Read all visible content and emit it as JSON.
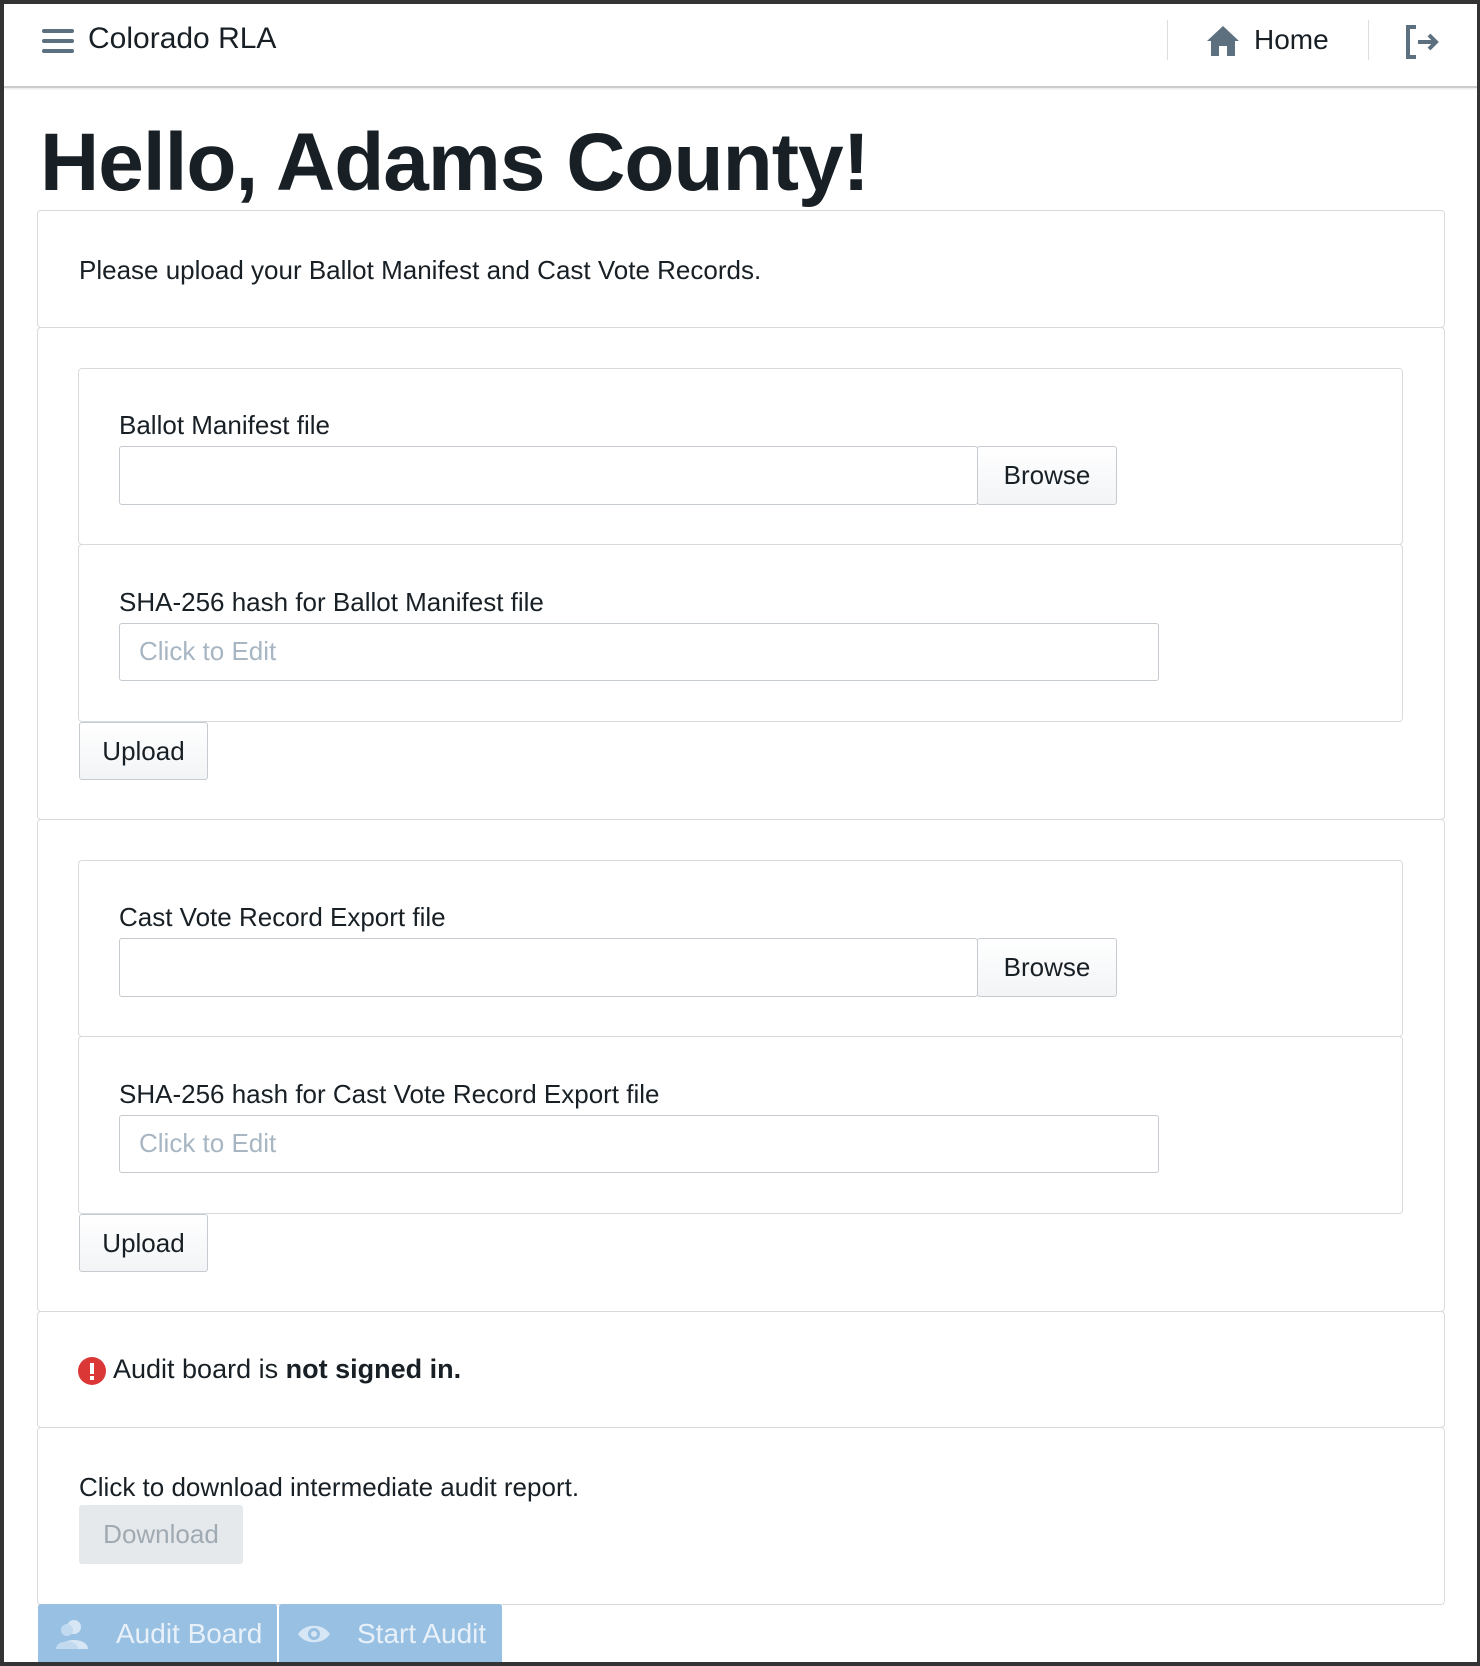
{
  "navbar": {
    "title": "Colorado RLA",
    "home_label": "Home",
    "menu_icon": "hamburger-icon",
    "home_icon": "home-icon",
    "logout_icon": "logout-icon"
  },
  "greeting": "Hello, Adams County!",
  "intro": "Please upload your Ballot Manifest and Cast Vote Records.",
  "manifest": {
    "file_label": "Ballot Manifest file",
    "browse_label": "Browse",
    "hash_label": "SHA-256 hash for Ballot Manifest file",
    "hash_placeholder": "Click to Edit",
    "upload_label": "Upload"
  },
  "cvr": {
    "file_label": "Cast Vote Record Export file",
    "browse_label": "Browse",
    "hash_label": "SHA-256 hash for Cast Vote Record Export file",
    "hash_placeholder": "Click to Edit",
    "upload_label": "Upload"
  },
  "audit_board_status": {
    "prefix": "Audit board is ",
    "emphasis": "not signed in.",
    "icon": "error-icon",
    "color": "#db3737"
  },
  "report": {
    "text": "Click to download intermediate audit report.",
    "download_label": "Download"
  },
  "bottom_buttons": [
    {
      "label": "Audit Board",
      "icon": "people-icon"
    },
    {
      "label": "Start Audit",
      "icon": "eye-icon"
    }
  ]
}
